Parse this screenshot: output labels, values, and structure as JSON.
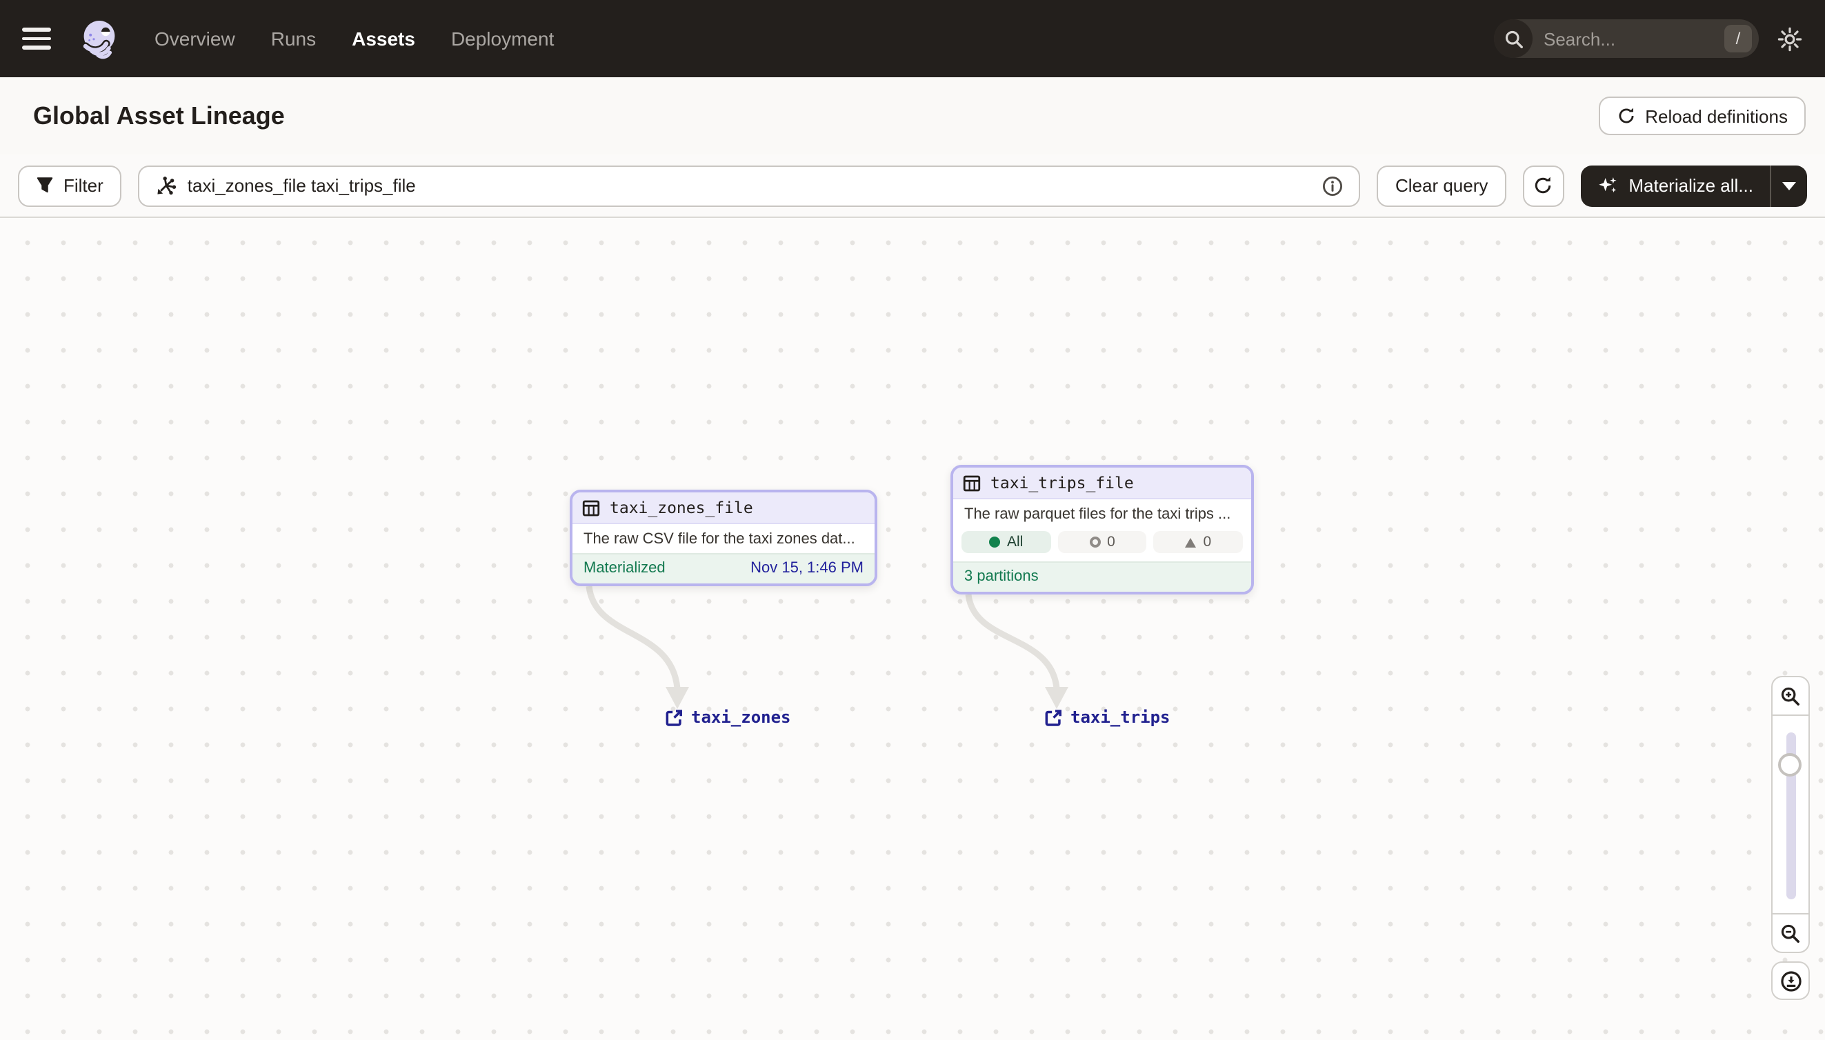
{
  "nav": {
    "menu_items": [
      {
        "label": "Overview",
        "active": false
      },
      {
        "label": "Runs",
        "active": false
      },
      {
        "label": "Assets",
        "active": true
      },
      {
        "label": "Deployment",
        "active": false
      }
    ],
    "search": {
      "placeholder": "Search...",
      "shortcut": "/"
    }
  },
  "header": {
    "title": "Global Asset Lineage",
    "reload_button": "Reload definitions"
  },
  "toolbar": {
    "filter_label": "Filter",
    "query_value": "taxi_zones_file taxi_trips_file",
    "clear_button": "Clear query",
    "materialize_button": "Materialize all..."
  },
  "graph": {
    "nodes": [
      {
        "title": "taxi_zones_file",
        "description": "The raw CSV file for the taxi zones dat...",
        "status": "Materialized",
        "timestamp": "Nov 15, 1:46 PM"
      },
      {
        "title": "taxi_trips_file",
        "description": "The raw parquet files for the taxi trips ...",
        "pills": [
          {
            "label": "All"
          },
          {
            "label": "0"
          },
          {
            "label": "0"
          }
        ],
        "footer": "3 partitions"
      }
    ],
    "links": [
      {
        "label": "taxi_zones"
      },
      {
        "label": "taxi_trips"
      }
    ]
  },
  "colors": {
    "nav_background": "#231F1C",
    "accent_purple": "#B9B4EE",
    "node_header_purple": "#ECEAFA",
    "materialized_green": "#12794F",
    "timestamp_navy": "#21219C",
    "link_navy": "#21218F"
  }
}
